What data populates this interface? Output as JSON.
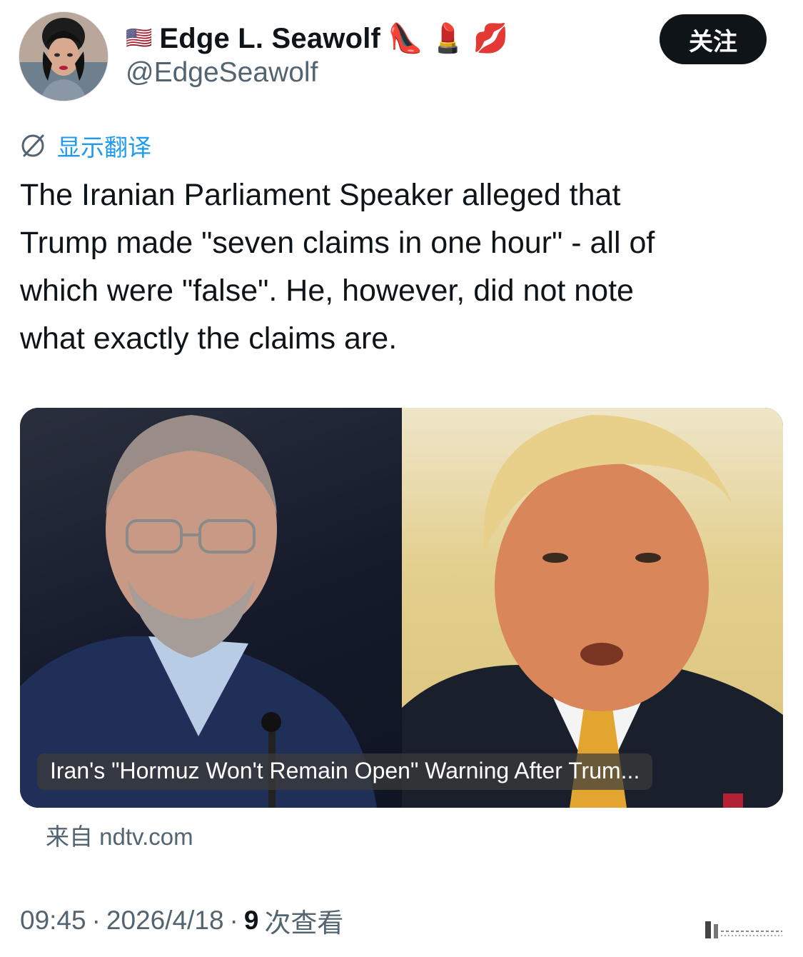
{
  "author": {
    "flag": "🇺🇸",
    "display_name": "Edge L. Seawolf",
    "name_emojis": [
      "👠",
      "💄",
      "💋"
    ],
    "handle": "@EdgeSeawolf",
    "follow_label": "关注"
  },
  "translate": {
    "icon": "globe-translate-icon",
    "label": "显示翻译"
  },
  "tweet": {
    "text": "The Iranian Parliament Speaker alleged that\nTrump made \"seven claims in  one hour\" - all of\nwhich were \"false\". He, however, did not note\nwhat  exactly the claims are."
  },
  "link_card": {
    "caption": "Iran's \"Hormuz Won't Remain Open\" Warning After Trum...",
    "source_prefix": "来自",
    "source_domain": "ndtv.com"
  },
  "meta": {
    "time": "09:45",
    "separator": "·",
    "date": "2026/4/18",
    "views_count": "9",
    "views_label": "次查看"
  },
  "colors": {
    "accent": "#1d9bf0",
    "text_primary": "#0f1419",
    "text_secondary": "#536471",
    "button_bg": "#0f1419"
  }
}
